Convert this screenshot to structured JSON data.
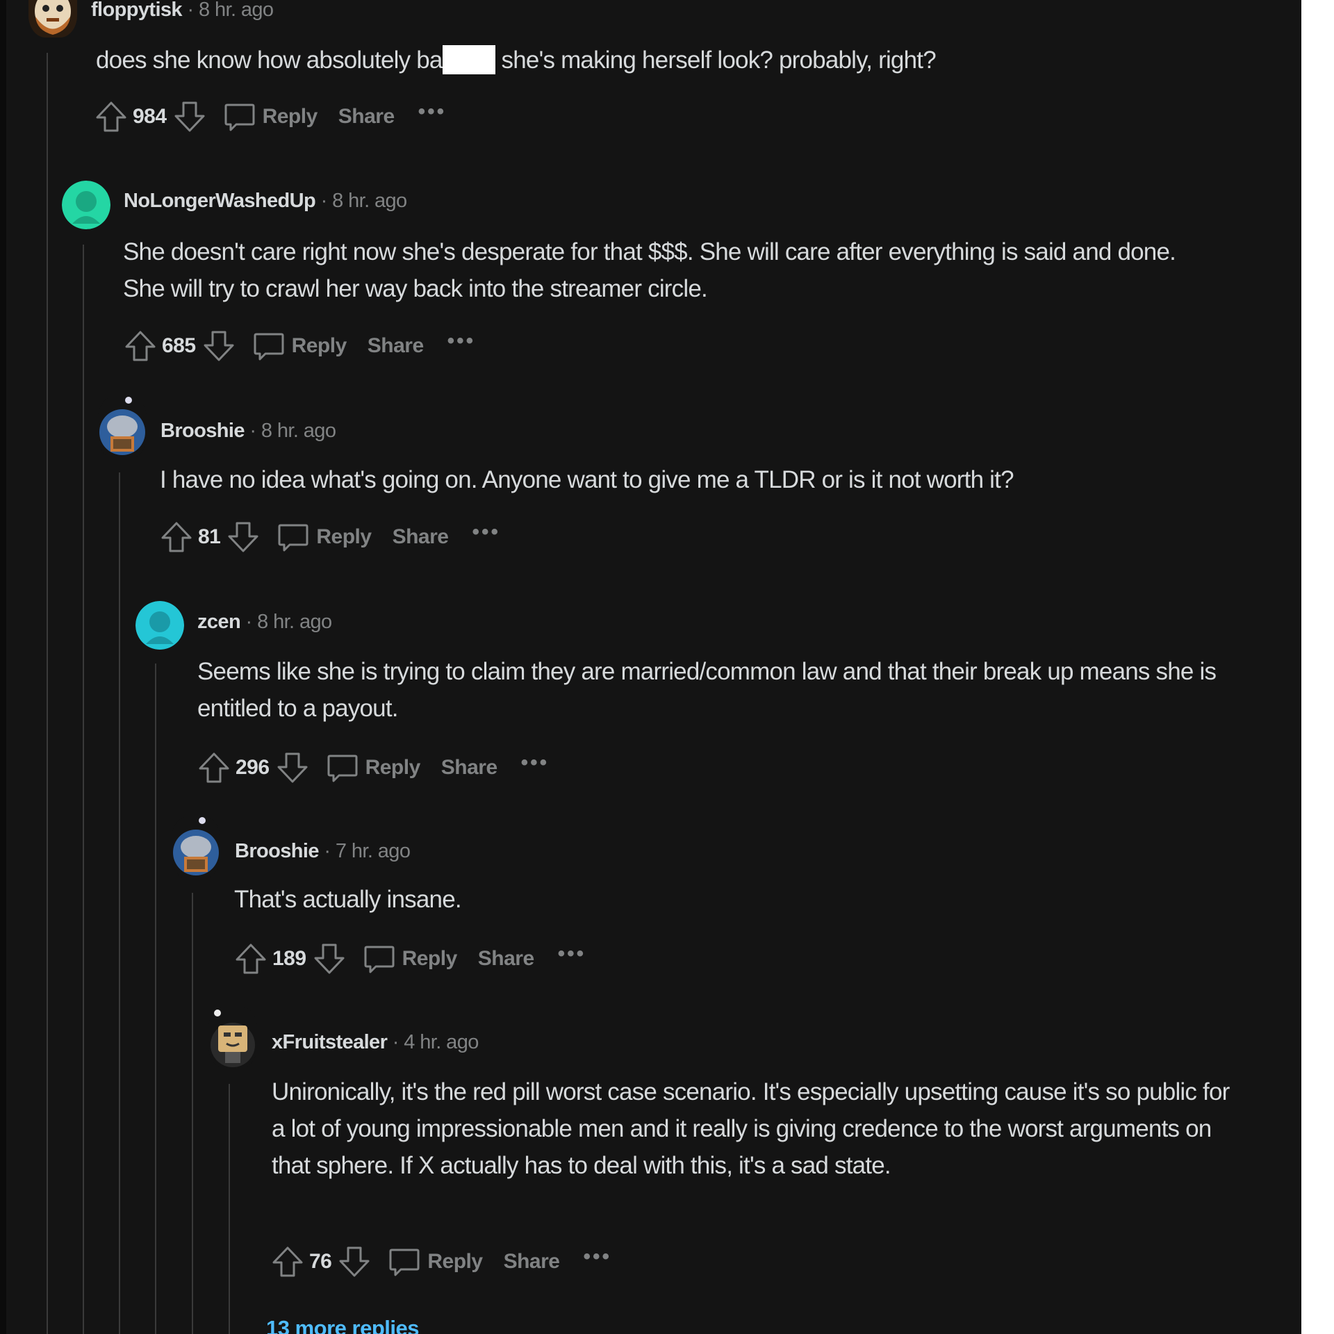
{
  "separator": "·",
  "labels": {
    "reply": "Reply",
    "share": "Share",
    "more": "•••"
  },
  "comments": [
    {
      "username": "floppytisk",
      "time": "8 hr. ago",
      "text_before_redaction": "does she know how absolutely ba",
      "text_after_redaction": " she's making herself look? probably, right?",
      "votes": "984",
      "avatar_color": "#c98a4a"
    },
    {
      "username": "NoLongerWashedUp",
      "time": "8 hr. ago",
      "text": "She doesn't care right now she's desperate for that $$$. She will care after everything is said and done. She will try to crawl her way back into the streamer circle.",
      "votes": "685",
      "avatar_color": "#24d6a4"
    },
    {
      "username": "Brooshie",
      "time": "8 hr. ago",
      "text": "I have no idea what's going on. Anyone want to give me a TLDR or is it not worth it?",
      "votes": "81",
      "avatar_color": "#3a6fb5"
    },
    {
      "username": "zcen",
      "time": "8 hr. ago",
      "text": "Seems like she is trying to claim they are married/common law and that their break up means she is entitled to a payout.",
      "votes": "296",
      "avatar_color": "#24c6d6"
    },
    {
      "username": "Brooshie",
      "time": "7 hr. ago",
      "text": "That's actually insane.",
      "votes": "189",
      "avatar_color": "#3a6fb5"
    },
    {
      "username": "xFruitstealer",
      "time": "4 hr. ago",
      "text": "Unironically, it's the red pill worst case scenario. It's especially upsetting cause it's so public for a lot of young impressionable men and it really is giving credence to the worst arguments on that sphere. If X actually has to deal with this, it's a sad state.",
      "votes": "76",
      "avatar_color": "#c8a468"
    }
  ],
  "more_replies": "13 more replies",
  "colors": {
    "background": "#141414",
    "text": "#d7dadc",
    "muted": "#818384",
    "link": "#4fbcff",
    "thread_line": "#3a3a3a"
  }
}
